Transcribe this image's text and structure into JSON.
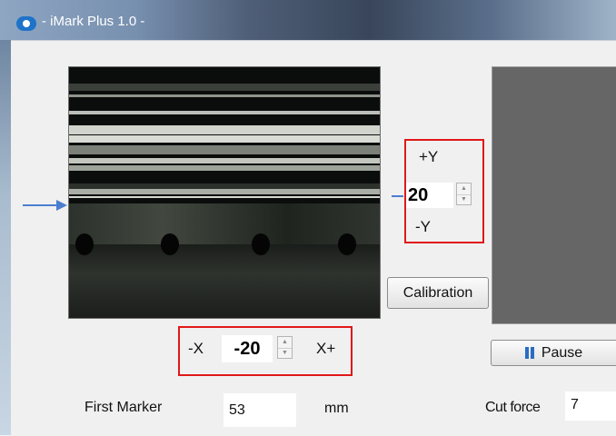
{
  "window": {
    "title": "- iMark Plus 1.0 -",
    "icon": "app-eye-icon"
  },
  "y_control": {
    "plus_label": "+Y",
    "value": "20",
    "minus_label": "-Y"
  },
  "x_control": {
    "minus_label": "-X",
    "value": "-20",
    "plus_label": "X+"
  },
  "buttons": {
    "calibration": "Calibration",
    "pause": "Pause"
  },
  "first_marker": {
    "label": "First Marker",
    "value": "53",
    "unit": "mm"
  },
  "cut_force": {
    "label": "Cut force",
    "value": "7"
  },
  "colors": {
    "highlight_box": "#e01818",
    "guide_arrow": "#4a7fd0"
  }
}
